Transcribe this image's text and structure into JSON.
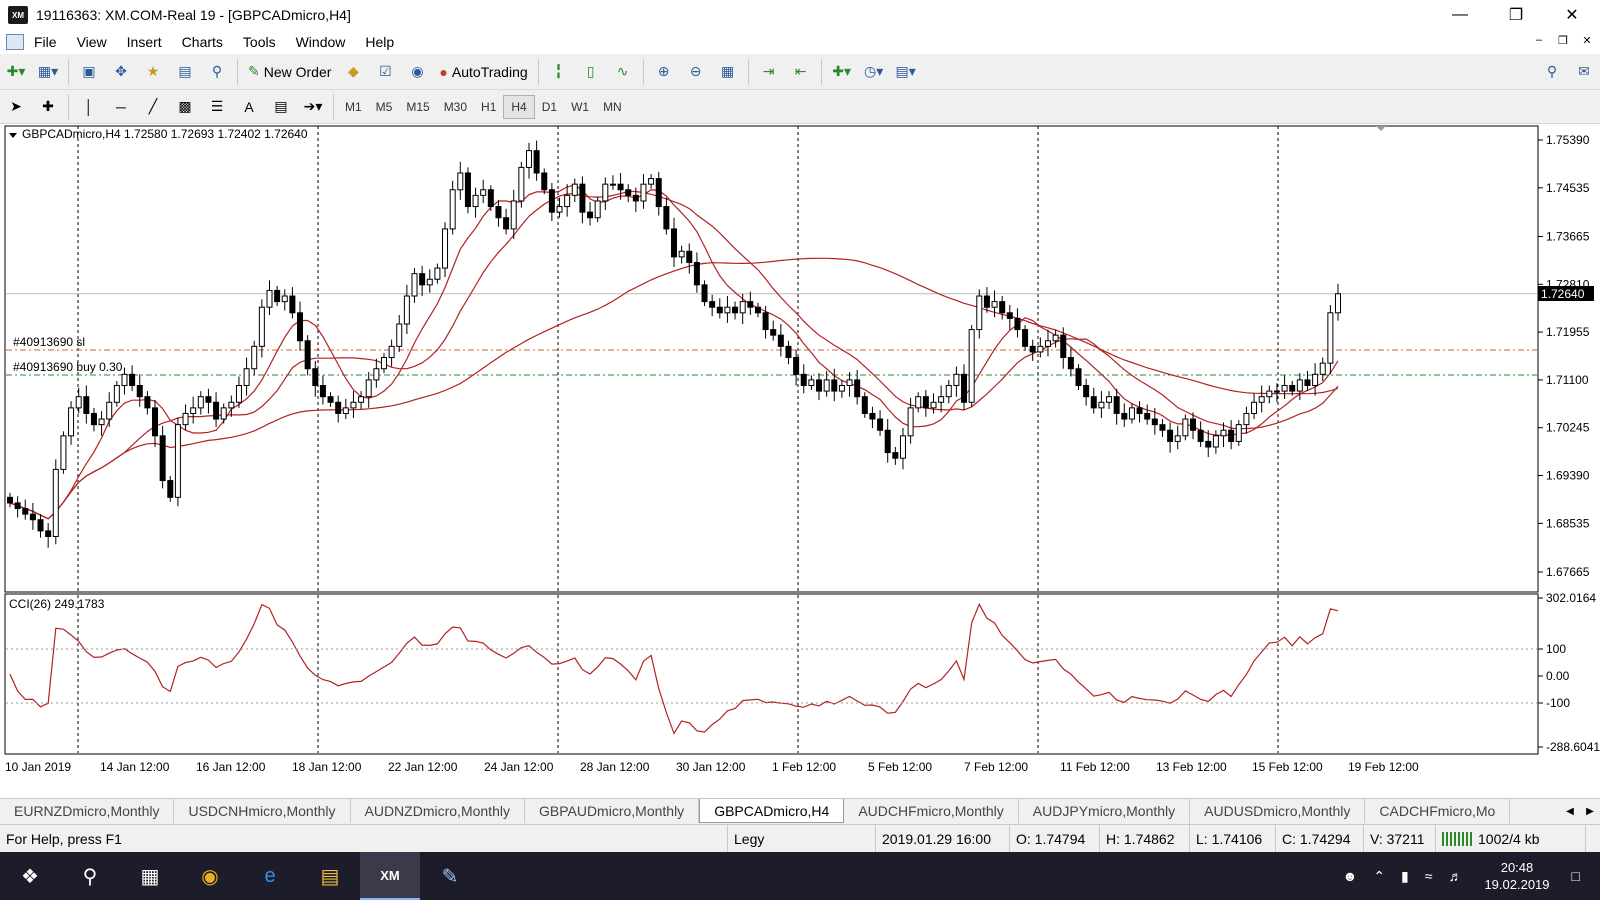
{
  "window": {
    "title": "19116363: XM.COM-Real 19 - [GBPCADmicro,H4]",
    "logo": "XM"
  },
  "menu": [
    "File",
    "View",
    "Insert",
    "Charts",
    "Tools",
    "Window",
    "Help"
  ],
  "toolbar": {
    "new_order": "New Order",
    "autotrading": "AutoTrading"
  },
  "timeframes": [
    "M1",
    "M5",
    "M15",
    "M30",
    "H1",
    "H4",
    "D1",
    "W1",
    "MN"
  ],
  "active_timeframe": "H4",
  "chart": {
    "header": "GBPCADmicro,H4  1.72580 1.72693 1.72402 1.72640",
    "order_sl_label": "#40913690 sl",
    "order_buy_label": "#40913690 buy 0.30",
    "current_price": "1.72640",
    "price_ticks": [
      "1.75390",
      "1.74535",
      "1.73665",
      "1.72810",
      "1.71955",
      "1.71100",
      "1.70245",
      "1.69390",
      "1.68535",
      "1.67665"
    ],
    "cci_label": "CCI(26) 249.1783",
    "cci_ticks": [
      "302.0164",
      "100",
      "0.00",
      "-100",
      "-288.6041"
    ],
    "date_ticks": [
      "10 Jan 2019",
      "14 Jan 12:00",
      "16 Jan 12:00",
      "18 Jan 12:00",
      "22 Jan 12:00",
      "24 Jan 12:00",
      "28 Jan 12:00",
      "30 Jan 12:00",
      "1 Feb 12:00",
      "5 Feb 12:00",
      "7 Feb 12:00",
      "11 Feb 12:00",
      "13 Feb 12:00",
      "15 Feb 12:00",
      "19 Feb 12:00"
    ],
    "colors": {
      "candle": "#000000",
      "ma": "#b22222",
      "sl_line": "#cc6633",
      "buy_line": "#2e8b2e",
      "cci": "#b22222"
    }
  },
  "tabs": [
    "EURNZDmicro,Monthly",
    "USDCNHmicro,Monthly",
    "AUDNZDmicro,Monthly",
    "GBPAUDmicro,Monthly",
    "GBPCADmicro,H4",
    "AUDCHFmicro,Monthly",
    "AUDJPYmicro,Monthly",
    "AUDUSDmicro,Monthly",
    "CADCHFmicro,Mo"
  ],
  "active_tab": "GBPCADmicro,H4",
  "status": {
    "help": "For Help, press F1",
    "profile": "Legy",
    "datetime": "2019.01.29 16:00",
    "open": "O: 1.74794",
    "high": "H: 1.74862",
    "low": "L: 1.74106",
    "close": "C: 1.74294",
    "volume": "V: 37211",
    "traffic": "1002/4 kb"
  },
  "taskbar": {
    "time": "20:48",
    "date": "19.02.2019"
  }
}
